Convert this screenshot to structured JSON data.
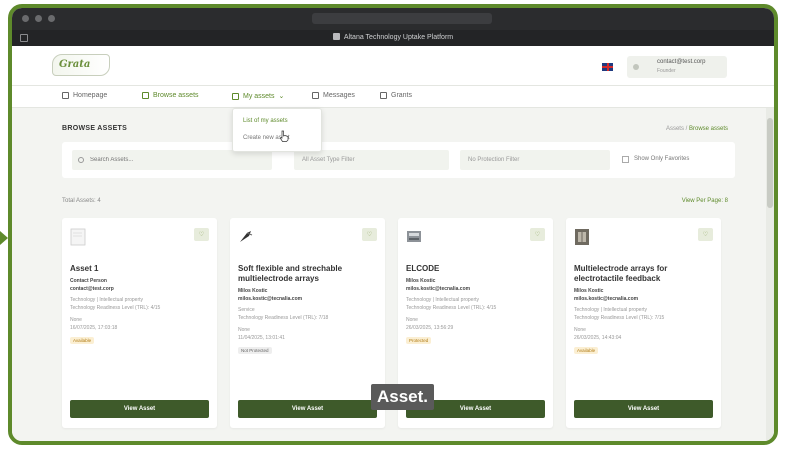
{
  "window": {
    "title": "Altana Technology Uptake Platform"
  },
  "header": {
    "logo_text": "Grata",
    "user_email": "contact@test.corp",
    "user_role": "Founder"
  },
  "nav": {
    "items": [
      {
        "label": "Homepage"
      },
      {
        "label": "Browse assets"
      },
      {
        "label": "My assets"
      },
      {
        "label": "Messages"
      },
      {
        "label": "Grants"
      }
    ]
  },
  "dropdown": {
    "items": [
      {
        "label": "List of my assets"
      },
      {
        "label": "Create new asset"
      }
    ]
  },
  "page": {
    "title": "BROWSE ASSETS",
    "breadcrumb_home": "Assets",
    "breadcrumb_current": "Browse assets"
  },
  "filters": {
    "search_placeholder": "Search Assets...",
    "asset_type": "All Asset Type Filter",
    "protection": "No Protection Filter",
    "favorites_label": "Show Only Favorites"
  },
  "summary": {
    "total_label": "Total Assets: 4",
    "per_page_label": "View Per Page: 8"
  },
  "cards": [
    {
      "title": "Asset 1",
      "author": "Contact Person",
      "email": "contact@test.corp",
      "category": "Technology | Intellectual property",
      "trl": "Technology Readiness Level (TRL): 4/15",
      "sector": "None",
      "date": "16/07/2025, 17:03:18",
      "status": "Available",
      "button": "View Asset"
    },
    {
      "title": "Soft flexible and strechable multielectrode arrays",
      "author": "Milos Kostic",
      "email": "milos.kostic@tecnalia.com",
      "category": "Service",
      "trl": "Technology Readiness Level (TRL): 7/18",
      "sector": "None",
      "date": "11/04/2025, 13:01:41",
      "status": "Not Protected",
      "button": "View Asset"
    },
    {
      "title": "ELCODE",
      "author": "Milos Kostic",
      "email": "milos.kostic@tecnalia.com",
      "category": "Technology | Intellectual property",
      "trl": "Technology Readiness Level (TRL): 4/15",
      "sector": "None",
      "date": "26/03/2025, 13:56:29",
      "status": "Protected",
      "button": "View Asset"
    },
    {
      "title": "Multielectrode arrays for electrotactile feedback",
      "author": "Milos Kostic",
      "email": "milos.kostic@tecnalia.com",
      "category": "Technology | Intellectual property",
      "trl": "Technology Readiness Level (TRL): 7/15",
      "sector": "None",
      "date": "26/03/2025, 14:43:04",
      "status": "Available",
      "button": "View Asset"
    }
  ],
  "caption": "Asset.",
  "colors": {
    "accent": "#5e8a2b",
    "button": "#3e5a2a",
    "frame": "#5e8a2b"
  }
}
